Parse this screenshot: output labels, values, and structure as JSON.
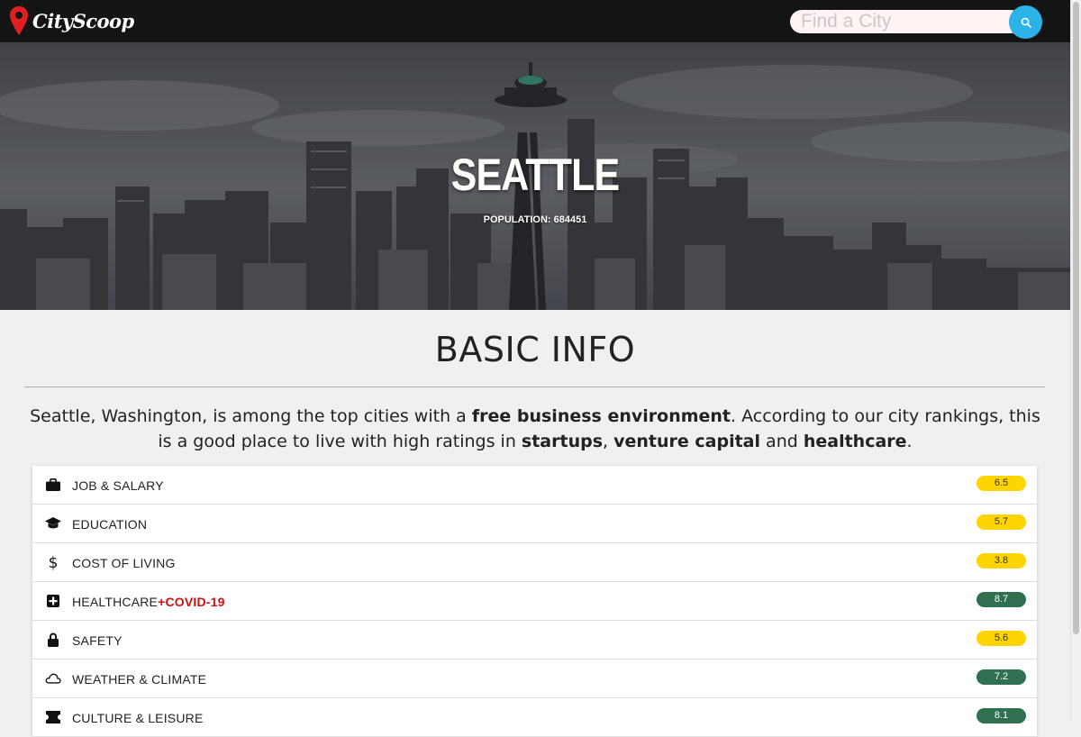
{
  "brand": {
    "name": "CityScoop"
  },
  "search": {
    "placeholder": "Find a City"
  },
  "hero": {
    "city": "SEATTLE",
    "population_label": "POPULATION:",
    "population": "684451"
  },
  "basic_info": {
    "title": "BASIC INFO",
    "summary": {
      "p1": "Seattle, Washington, is among the top cities with a ",
      "b1": "free business environment",
      "p2": ". According to our city rankings, this is a good place to live with high ratings in ",
      "b2": "startups",
      "p3": ", ",
      "b3": "venture capital",
      "p4": " and ",
      "b4": "healthcare",
      "p5": "."
    }
  },
  "categories": [
    {
      "label": "JOB & SALARY",
      "extra": "",
      "score": "6.5",
      "icon": "briefcase-icon",
      "color": "#ffd400"
    },
    {
      "label": "EDUCATION",
      "extra": "",
      "score": "5.7",
      "icon": "graduation-cap-icon",
      "color": "#ffd400"
    },
    {
      "label": "COST OF LIVING",
      "extra": "",
      "score": "3.8",
      "icon": "dollar-icon",
      "color": "#ffd400"
    },
    {
      "label": "HEALTHCARE",
      "extra": "+COVID-19",
      "score": "8.7",
      "icon": "medical-cross-icon",
      "color": "#2e7050"
    },
    {
      "label": "SAFETY",
      "extra": "",
      "score": "5.6",
      "icon": "lock-icon",
      "color": "#ffd400"
    },
    {
      "label": "WEATHER & CLIMATE",
      "extra": "",
      "score": "7.2",
      "icon": "cloud-icon",
      "color": "#2e7050"
    },
    {
      "label": "CULTURE & LEISURE",
      "extra": "",
      "score": "8.1",
      "icon": "ticket-icon",
      "color": "#2e7050"
    }
  ],
  "colors": {
    "nav_bg": "#141414",
    "accent": "#2bb2e6",
    "logo_pin": "#e02020"
  }
}
